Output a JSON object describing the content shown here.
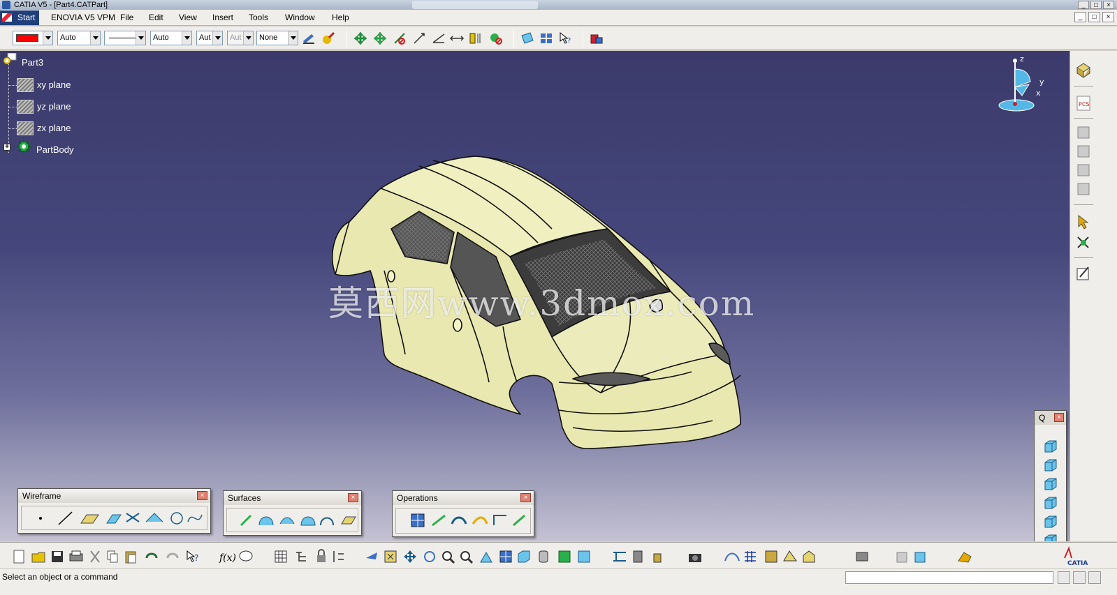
{
  "window": {
    "title": "CATIA V5 - [Part4.CATPart]",
    "controls": [
      "_",
      "□",
      "×"
    ]
  },
  "menu": {
    "start": "Start",
    "items": [
      "ENOVIA V5 VPM",
      "File",
      "Edit",
      "View",
      "Insert",
      "Tools",
      "Window",
      "Help"
    ],
    "doc_controls": [
      "_",
      "□",
      "×"
    ]
  },
  "properties_toolbar": {
    "color_value": "#ff0000",
    "transparency": "Auto",
    "linetype_value": "solid",
    "thickness": "Auto",
    "point_symbol": "Aut",
    "layer_disabled": "Aut",
    "layer": "None"
  },
  "tree": {
    "root": "Part3",
    "planes": [
      "xy plane",
      "yz plane",
      "zx plane"
    ],
    "body": "PartBody"
  },
  "compass": {
    "z": "z",
    "y": "y",
    "x": "x"
  },
  "watermark": "莫西网www.3dmox.com",
  "floating_toolbars": {
    "wireframe": {
      "title": "Wireframe",
      "close": "×"
    },
    "surfaces": {
      "title": "Surfaces",
      "close": "×"
    },
    "operations": {
      "title": "Operations",
      "close": "×"
    },
    "views": {
      "title": "Q",
      "close": "×"
    }
  },
  "status": {
    "message": "Select an object or a command",
    "command_input": ""
  },
  "brand": {
    "catia_label": "CATIA",
    "viewport_top": "#3b3a6b",
    "viewport_bottom": "#c4c2d2",
    "car_fill": "#e8e8b0",
    "ui_bg": "#f0eeea"
  }
}
